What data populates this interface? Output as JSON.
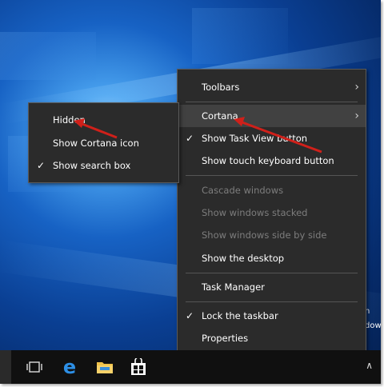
{
  "context_menu": {
    "items": [
      {
        "label": "Toolbars",
        "has_submenu": true
      },
      {
        "label": "Cortana",
        "has_submenu": true,
        "highlighted": true
      },
      {
        "label": "Show Task View button",
        "checked": true
      },
      {
        "label": "Show touch keyboard button"
      },
      {
        "label": "Cascade windows",
        "disabled": true
      },
      {
        "label": "Show windows stacked",
        "disabled": true
      },
      {
        "label": "Show windows side by side",
        "disabled": true
      },
      {
        "label": "Show the desktop"
      },
      {
        "label": "Task Manager"
      },
      {
        "label": "Lock the taskbar",
        "checked": true
      },
      {
        "label": "Properties"
      }
    ]
  },
  "cortana_submenu": {
    "items": [
      {
        "label": "Hidden"
      },
      {
        "label": "Show Cortana icon"
      },
      {
        "label": "Show search box",
        "checked": true
      }
    ]
  },
  "glyphs": {
    "check": "✓",
    "chevron": "›",
    "tray_up": "∧"
  },
  "taskbar": {
    "icons": [
      "task-view-icon",
      "edge-icon",
      "file-explorer-icon",
      "store-icon"
    ],
    "edge_letter": "e"
  },
  "background_text": {
    "line1": "n",
    "line2": "dow"
  },
  "annotation_color": "#d0201a"
}
